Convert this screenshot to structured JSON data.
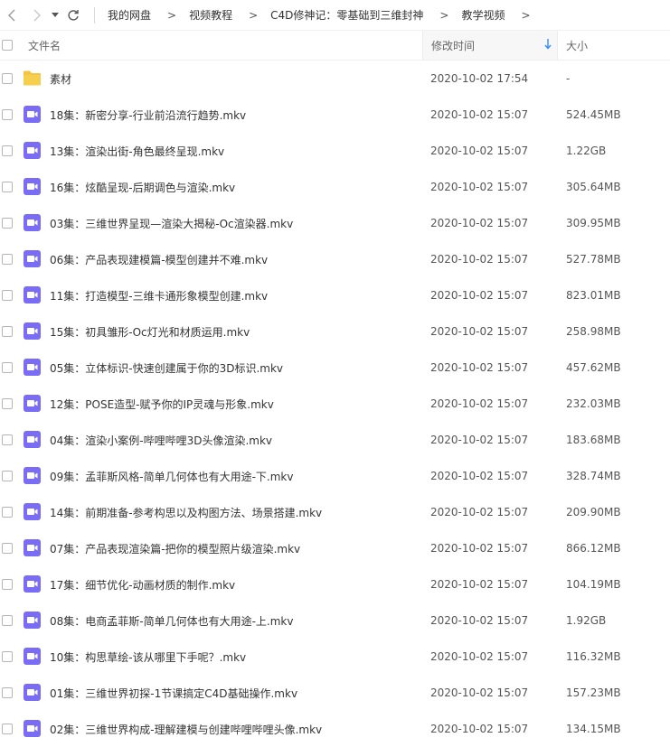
{
  "colors": {
    "video_icon": "#7b6cf6",
    "folder_icon": "#f5c542",
    "sort_arrow": "#3b8cff"
  },
  "breadcrumb": [
    "我的网盘",
    "视频教程",
    "C4D修神记：零基础到三维封神",
    "教学视频"
  ],
  "breadcrumb_separator": ">",
  "columns": {
    "name": "文件名",
    "time": "修改时间",
    "size": "大小"
  },
  "files": [
    {
      "icon": "folder-icon",
      "name": "素材",
      "time": "2020-10-02 17:54",
      "size": "-"
    },
    {
      "icon": "video-file-icon",
      "name": "18集：新密分享-行业前沿流行趋势.mkv",
      "time": "2020-10-02 15:07",
      "size": "524.45MB"
    },
    {
      "icon": "video-file-icon",
      "name": "13集：渲染出街-角色最终呈现.mkv",
      "time": "2020-10-02 15:07",
      "size": "1.22GB"
    },
    {
      "icon": "video-file-icon",
      "name": "16集：炫酷呈现-后期调色与渲染.mkv",
      "time": "2020-10-02 15:07",
      "size": "305.64MB"
    },
    {
      "icon": "video-file-icon",
      "name": "03集：三维世界呈现—渲染大揭秘-Oc渲染器.mkv",
      "time": "2020-10-02 15:07",
      "size": "309.95MB"
    },
    {
      "icon": "video-file-icon",
      "name": "06集：产品表现建模篇-模型创建并不难.mkv",
      "time": "2020-10-02 15:07",
      "size": "527.78MB"
    },
    {
      "icon": "video-file-icon",
      "name": "11集：打造模型-三维卡通形象模型创建.mkv",
      "time": "2020-10-02 15:07",
      "size": "823.01MB"
    },
    {
      "icon": "video-file-icon",
      "name": "15集：初具雏形-Oc灯光和材质运用.mkv",
      "time": "2020-10-02 15:07",
      "size": "258.98MB"
    },
    {
      "icon": "video-file-icon",
      "name": "05集：立体标识-快速创建属于你的3D标识.mkv",
      "time": "2020-10-02 15:07",
      "size": "457.62MB"
    },
    {
      "icon": "video-file-icon",
      "name": "12集：POSE造型-赋予你的IP灵魂与形象.mkv",
      "time": "2020-10-02 15:07",
      "size": "232.03MB"
    },
    {
      "icon": "video-file-icon",
      "name": "04集：渲染小案例-哔哩哔哩3D头像渲染.mkv",
      "time": "2020-10-02 15:07",
      "size": "183.68MB"
    },
    {
      "icon": "video-file-icon",
      "name": "09集：孟菲斯风格-简单几何体也有大用途-下.mkv",
      "time": "2020-10-02 15:07",
      "size": "328.74MB"
    },
    {
      "icon": "video-file-icon",
      "name": "14集：前期准备-参考构思以及构图方法、场景搭建.mkv",
      "time": "2020-10-02 15:07",
      "size": "209.90MB"
    },
    {
      "icon": "video-file-icon",
      "name": "07集：产品表现渲染篇-把你的模型照片级渲染.mkv",
      "time": "2020-10-02 15:07",
      "size": "866.12MB"
    },
    {
      "icon": "video-file-icon",
      "name": "17集：细节优化-动画材质的制作.mkv",
      "time": "2020-10-02 15:07",
      "size": "104.19MB"
    },
    {
      "icon": "video-file-icon",
      "name": "08集：电商孟菲斯-简单几何体也有大用途-上.mkv",
      "time": "2020-10-02 15:07",
      "size": "1.92GB"
    },
    {
      "icon": "video-file-icon",
      "name": "10集：构思草绘-该从哪里下手呢？.mkv",
      "time": "2020-10-02 15:07",
      "size": "116.32MB"
    },
    {
      "icon": "video-file-icon",
      "name": "01集：三维世界初探-1节课搞定C4D基础操作.mkv",
      "time": "2020-10-02 15:07",
      "size": "157.23MB"
    },
    {
      "icon": "video-file-icon",
      "name": "02集：三维世界构成-理解建模与创建哔哩哔哩头像.mkv",
      "time": "2020-10-02 15:07",
      "size": "134.15MB"
    }
  ]
}
